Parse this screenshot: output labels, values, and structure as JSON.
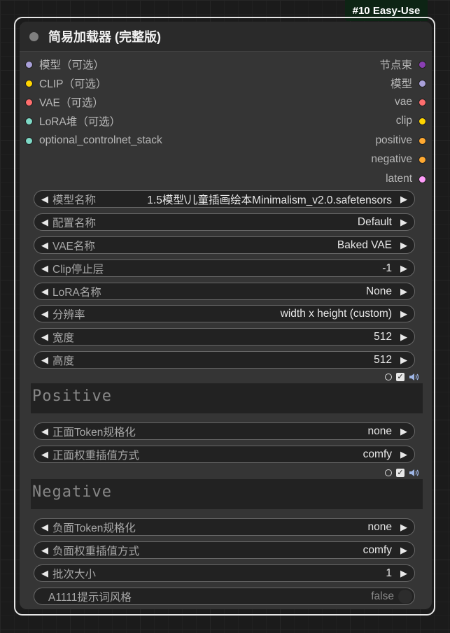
{
  "badge": "#10 Easy-Use",
  "node": {
    "title": "简易加载器 (完整版)"
  },
  "inputs": [
    {
      "label": "模型（可选）",
      "color": "#a9a0d9"
    },
    {
      "label": "CLIP（可选）",
      "color": "#ffd500"
    },
    {
      "label": "VAE（可选）",
      "color": "#ff6e6e"
    },
    {
      "label": "LoRA堆（可选）",
      "color": "#7ed9c6"
    },
    {
      "label": "optional_controlnet_stack",
      "color": "#7ed9c6"
    }
  ],
  "outputs": [
    {
      "label": "节点束",
      "color": "#8a3fb3"
    },
    {
      "label": "模型",
      "color": "#a9a0d9"
    },
    {
      "label": "vae",
      "color": "#ff6e6e"
    },
    {
      "label": "clip",
      "color": "#ffd500"
    },
    {
      "label": "positive",
      "color": "#ffa931"
    },
    {
      "label": "negative",
      "color": "#ffa931"
    },
    {
      "label": "latent",
      "color": "#ff9cf9"
    }
  ],
  "widgets": {
    "ckpt": {
      "label": "模型名称",
      "value": "1.5模型\\儿童插画绘本Minimalism_v2.0.safetensors"
    },
    "config": {
      "label": "配置名称",
      "value": "Default"
    },
    "vae": {
      "label": "VAE名称",
      "value": "Baked VAE"
    },
    "clip_skip": {
      "label": "Clip停止层",
      "value": "-1"
    },
    "lora": {
      "label": "LoRA名称",
      "value": "None"
    },
    "resolution": {
      "label": "分辨率",
      "value": "width x height (custom)"
    },
    "width": {
      "label": "宽度",
      "value": "512"
    },
    "height": {
      "label": "高度",
      "value": "512"
    },
    "pos_token": {
      "label": "正面Token规格化",
      "value": "none"
    },
    "pos_weight": {
      "label": "正面权重插值方式",
      "value": "comfy"
    },
    "neg_token": {
      "label": "负面Token规格化",
      "value": "none"
    },
    "neg_weight": {
      "label": "负面权重插值方式",
      "value": "comfy"
    },
    "batch": {
      "label": "批次大小",
      "value": "1"
    },
    "a1111": {
      "label": "A1111提示词风格",
      "value": "false"
    }
  },
  "positive": {
    "placeholder": "Positive"
  },
  "negative": {
    "placeholder": "Negative"
  },
  "icons": {
    "toolbar": [
      "circle-icon",
      "checkbox-icon",
      "speaker-icon"
    ]
  }
}
